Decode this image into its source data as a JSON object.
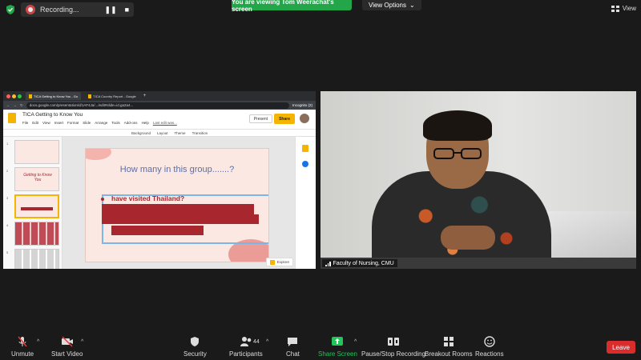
{
  "top_bar": {
    "recording_label": "Recording...",
    "viewing_banner": "You are viewing Tom Weerachat's screen",
    "view_options_label": "View Options",
    "view_label": "View"
  },
  "browser": {
    "tabs": [
      {
        "label": "TICA Getting to Know You - Go"
      },
      {
        "label": "TICA Country Report - Google"
      }
    ],
    "url": "docs.google.com/presentation/d/1AF4Ja/.../edit#slide=id.ga2a4...",
    "incognito_label": "Incognito (2)"
  },
  "docs": {
    "title": "TICA Getting to Know You",
    "menu": [
      "File",
      "Edit",
      "View",
      "Insert",
      "Format",
      "Slide",
      "Arrange",
      "Tools",
      "Add-ons",
      "Help"
    ],
    "last_edit": "Last edit was...",
    "present_label": "Present",
    "share_label": "Share",
    "toolbar_items": [
      "Background",
      "Layout",
      "Theme",
      "Transition"
    ],
    "explore_label": "Explore",
    "slide_numbers": [
      "1",
      "2",
      "3",
      "4",
      "5"
    ],
    "thumb2_text": "Getting to Know You"
  },
  "slide": {
    "title": "How many in this group.......?",
    "bullet": "have visited Thailand?"
  },
  "video": {
    "participant_name": "Faculty of Nursing, CMU"
  },
  "toolbar": {
    "unmute": "Unmute",
    "start_video": "Start Video",
    "security": "Security",
    "participants": "Participants",
    "participants_count": "44",
    "chat": "Chat",
    "share_screen": "Share Screen",
    "pause_stop_recording": "Pause/Stop Recording",
    "breakout_rooms": "Breakout Rooms",
    "reactions": "Reactions",
    "leave": "Leave"
  },
  "colors": {
    "zoom_green": "#23a64a",
    "leave_red": "#d92d2d",
    "slide_accent": "#a8262e"
  }
}
